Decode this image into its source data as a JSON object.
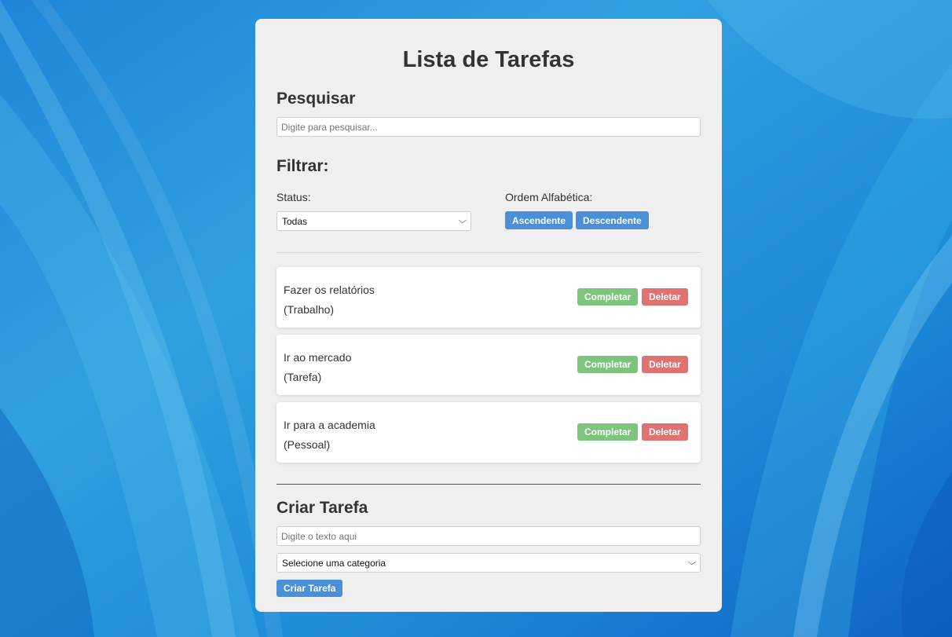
{
  "app": {
    "title": "Lista de Tarefas"
  },
  "search": {
    "heading": "Pesquisar",
    "placeholder": "Digite para pesquisar..."
  },
  "filter": {
    "heading": "Filtrar:",
    "status_label": "Status:",
    "status_selected": "Todas",
    "order_label": "Ordem Alfabética:",
    "asc_label": "Ascendente",
    "desc_label": "Descendente"
  },
  "tasks": [
    {
      "text": "Fazer os relatórios",
      "category": "(Trabalho)",
      "complete_label": "Completar",
      "delete_label": "Deletar"
    },
    {
      "text": "Ir ao mercado",
      "category": "(Tarefa)",
      "complete_label": "Completar",
      "delete_label": "Deletar"
    },
    {
      "text": "Ir para a academia",
      "category": "(Pessoal)",
      "complete_label": "Completar",
      "delete_label": "Deletar"
    }
  ],
  "create": {
    "heading": "Criar Tarefa",
    "text_placeholder": "Digite o texto aqui",
    "category_selected": "Selecione uma categoria",
    "submit_label": "Criar Tarefa"
  },
  "icons": {
    "select_arrow": "chevron-down-icon"
  },
  "colors": {
    "primary": "#4a90d9",
    "complete": "#7dc57d",
    "delete": "#e07272",
    "panel": "#efefef"
  }
}
